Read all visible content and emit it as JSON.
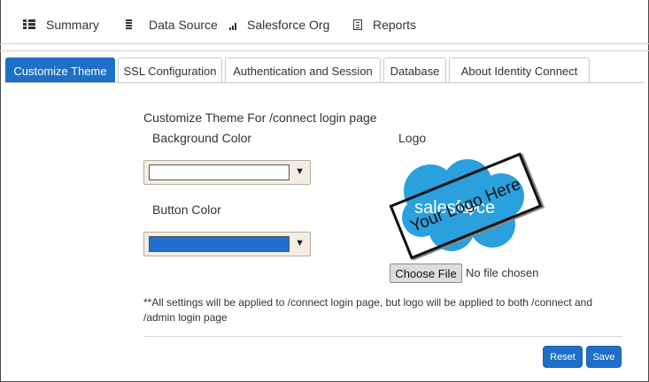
{
  "nav": {
    "items": [
      {
        "label": "Summary",
        "icon": "grid-icon"
      },
      {
        "label": "Data Source",
        "icon": "list-icon"
      },
      {
        "label": "Salesforce Org",
        "icon": "bar-chart-icon"
      },
      {
        "label": "Reports",
        "icon": "document-icon"
      }
    ]
  },
  "tabs": [
    {
      "label": "Customize Theme",
      "active": true
    },
    {
      "label": "SSL Configuration",
      "active": false
    },
    {
      "label": "Authentication and Session",
      "active": false
    },
    {
      "label": "Database",
      "active": false
    },
    {
      "label": "About Identity Connect",
      "active": false
    }
  ],
  "content": {
    "section_title": "Customize Theme For /connect login page",
    "background_color_label": "Background Color",
    "background_color_value": "#ffffff",
    "button_color_label": "Button Color",
    "button_color_value": "#1f6fd1",
    "logo_label": "Logo",
    "logo_brand_text": "salesforce",
    "logo_stamp_text": "Your Logo Here",
    "choose_file_label": "Choose File",
    "file_status": "No file chosen",
    "note": "**All settings will be applied to /connect login page, but logo will be applied to both /connect and /admin login page"
  },
  "actions": {
    "reset_label": "Reset",
    "save_label": "Save"
  },
  "colors": {
    "accent": "#1f6fc8",
    "cloud": "#2aa0dc",
    "dropdown_bg": "#f3ede3"
  }
}
